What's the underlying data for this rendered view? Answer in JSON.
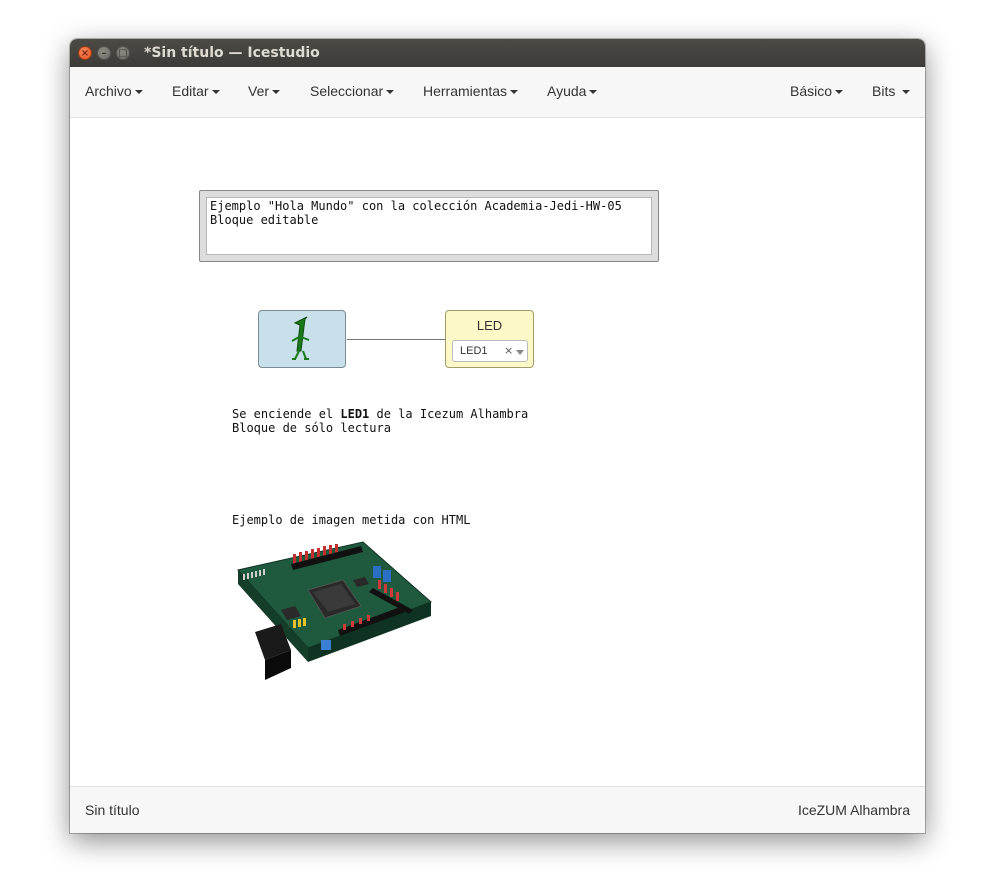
{
  "window": {
    "title": "*Sin título — Icestudio",
    "close_glyph": "×",
    "minimize_glyph": "–",
    "maximize_glyph": "□"
  },
  "menubar": {
    "left": [
      {
        "label": "Archivo"
      },
      {
        "label": "Editar"
      },
      {
        "label": "Ver"
      },
      {
        "label": "Seleccionar"
      },
      {
        "label": "Herramientas"
      },
      {
        "label": "Ayuda"
      }
    ],
    "right": [
      {
        "label": "Básico"
      },
      {
        "label": "Bits"
      }
    ]
  },
  "canvas": {
    "editable_info": {
      "line1": "Ejemplo \"Hola Mundo\" con la colección Academia-Jedi-HW-05",
      "line2": "Bloque editable"
    },
    "constant_block": {
      "icon": "one-constant-icon",
      "icon_color": "#1a7a1a"
    },
    "led_block": {
      "title": "LED",
      "selected_pin": "LED1",
      "clear_glyph": "×"
    },
    "readonly_info": {
      "line1_prefix": "Se enciende el ",
      "line1_bold": "LED1",
      "line1_suffix": " de la Icezum Alhambra",
      "line2": "Bloque de sólo lectura"
    },
    "image_caption": "Ejemplo de imagen metida con HTML",
    "board_image": "fpga-board-image"
  },
  "statusbar": {
    "left": "Sin título",
    "right": "IceZUM Alhambra"
  },
  "colors": {
    "constant_block_bg": "#c7e0ea",
    "led_block_bg": "#fdf8c7",
    "board_pcb": "#1f5a3e"
  }
}
